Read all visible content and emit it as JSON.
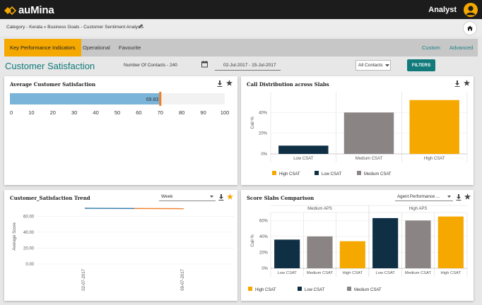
{
  "app": {
    "brand": "auMina",
    "user": "Analyst"
  },
  "breadcrumb": {
    "text": "Category - Kerala » Business Goals - Customer Sentiment Analysis"
  },
  "tabs": [
    {
      "label": "Key Performance Indicators",
      "active": true
    },
    {
      "label": "Operational",
      "active": false
    },
    {
      "label": "Favourite",
      "active": false
    }
  ],
  "tab_links": {
    "custom": "Custom",
    "advanced": "Advanced"
  },
  "header": {
    "title": "Customer Satisfaction",
    "contacts": "Number Of Contacts - 240",
    "date_range": "02-Jul-2017 - 15-Jul-2017",
    "contact_filter": "All Contacts",
    "filters_label": "FILTERS"
  },
  "colors": {
    "accent": "#f5a800",
    "teal": "#127a7a",
    "bar_blue": "#7ab4d9",
    "navy": "#0e2f44",
    "gray": "#8a8484"
  },
  "cards": {
    "avg_csat": {
      "title": "Average Customer Satisfaction"
    },
    "call_dist": {
      "title": "Call Distribution across Slabs"
    },
    "trend": {
      "title": "Customer_Satisfaction Trend",
      "select": "Week"
    },
    "score_slabs": {
      "title": "Score Slabs Comparison",
      "select": "Agent Performance ..."
    }
  },
  "chart_data": [
    {
      "type": "bar",
      "orientation": "horizontal",
      "title": "Average Customer Satisfaction",
      "values": [
        69.83
      ],
      "value_label": "69.83",
      "xlim": [
        0,
        100
      ],
      "ticks": [
        "0",
        "10",
        "20",
        "30",
        "40",
        "50",
        "60",
        "70",
        "80",
        "90",
        "100"
      ],
      "target": 70
    },
    {
      "type": "bar",
      "title": "Call Distribution across Slabs",
      "ylabel": "Call %",
      "categories": [
        "Low CSAT",
        "Medium CSAT",
        "High CSAT"
      ],
      "values": [
        8,
        40,
        52
      ],
      "ylim": [
        0,
        60
      ],
      "yticks": [
        "0%",
        "20%",
        "40%"
      ],
      "legend": [
        "High CSAT",
        "Low CSAT",
        "Medium CSAT"
      ],
      "legend_position": "bottom-left"
    },
    {
      "type": "line",
      "title": "Customer_Satisfaction Trend",
      "ylabel": "Average Score",
      "categories": [
        "02-07-2017",
        "09-07-2017"
      ],
      "values": [
        70,
        69.5
      ],
      "ylim": [
        0,
        70
      ],
      "yticks": [
        "0.00",
        "20.00",
        "40.00",
        "60.00"
      ]
    },
    {
      "type": "bar",
      "title": "Score Slabs Comparison",
      "ylabel": "Call %",
      "groups": [
        "Medium APS",
        "High APS"
      ],
      "categories": [
        "Low CSAT",
        "Medium CSAT",
        "High CSAT",
        "Low CSAT",
        "Medium CSAT",
        "High CSAT"
      ],
      "values": [
        36,
        40,
        34,
        63,
        60,
        65
      ],
      "ylim": [
        0,
        70
      ],
      "yticks": [
        "0%",
        "20%",
        "40%",
        "60%"
      ],
      "legend": [
        "High CSAT",
        "Low CSAT",
        "Medium CSAT"
      ],
      "legend_position": "bottom-left"
    }
  ]
}
